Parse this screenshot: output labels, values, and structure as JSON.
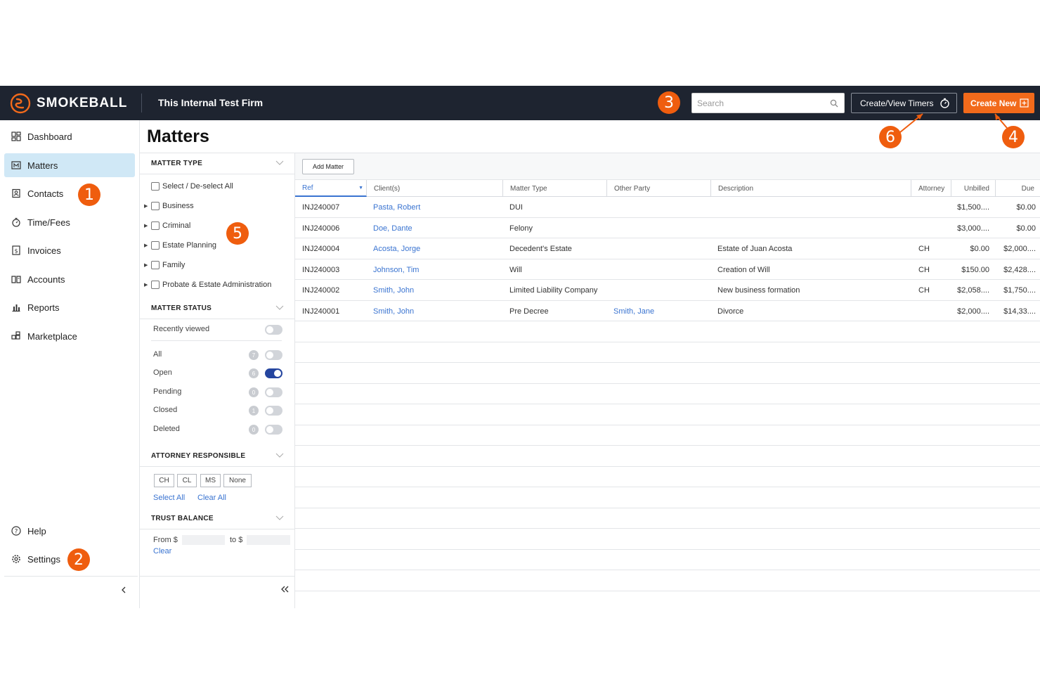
{
  "brand": {
    "logo_text": "SMOKEBALL",
    "firm_name": "This Internal Test Firm",
    "accent": "#f26a1b",
    "topbar_color": "#1e2430"
  },
  "header": {
    "search_placeholder": "Search",
    "timers_label": "Create/View Timers",
    "create_new_label": "Create New"
  },
  "callouts": [
    "1",
    "2",
    "3",
    "4",
    "5",
    "6"
  ],
  "sidebar": {
    "items": [
      {
        "label": "Dashboard",
        "icon": "dashboard-icon"
      },
      {
        "label": "Matters",
        "icon": "matters-icon",
        "active": true
      },
      {
        "label": "Contacts",
        "icon": "contacts-icon"
      },
      {
        "label": "Time/Fees",
        "icon": "stopwatch-icon"
      },
      {
        "label": "Invoices",
        "icon": "invoice-icon"
      },
      {
        "label": "Accounts",
        "icon": "accounts-icon"
      },
      {
        "label": "Reports",
        "icon": "reports-icon"
      },
      {
        "label": "Marketplace",
        "icon": "marketplace-icon"
      }
    ],
    "help_label": "Help",
    "settings_label": "Settings"
  },
  "page": {
    "title": "Matters",
    "add_matter_label": "Add Matter"
  },
  "filters": {
    "matter_type": {
      "title": "MATTER TYPE",
      "select_all": "Select / De-select All",
      "types": [
        "Business",
        "Criminal",
        "Estate Planning",
        "Family",
        "Probate & Estate Administration"
      ]
    },
    "matter_status": {
      "title": "MATTER STATUS",
      "recently_viewed": "Recently viewed",
      "statuses": [
        {
          "label": "All",
          "count": "7",
          "on": false
        },
        {
          "label": "Open",
          "count": "6",
          "on": true
        },
        {
          "label": "Pending",
          "count": "0",
          "on": false
        },
        {
          "label": "Closed",
          "count": "1",
          "on": false
        },
        {
          "label": "Deleted",
          "count": "0",
          "on": false
        }
      ]
    },
    "attorney": {
      "title": "ATTORNEY RESPONSIBLE",
      "options": [
        "CH",
        "CL",
        "MS",
        "None"
      ],
      "select_all": "Select All",
      "clear_all": "Clear All"
    },
    "trust": {
      "title": "TRUST BALANCE",
      "from_label": "From $",
      "to_label": "to $",
      "clear_label": "Clear"
    }
  },
  "table": {
    "columns": [
      "Ref",
      "Client(s)",
      "Matter Type",
      "Other Party",
      "Description",
      "Attorney",
      "Unbilled",
      "Due"
    ],
    "rows": [
      {
        "ref": "INJ240007",
        "client": "Pasta, Robert",
        "type": "DUI",
        "other": "",
        "desc": "",
        "attorney": "",
        "unbilled": "$1,500....",
        "due": "$0.00"
      },
      {
        "ref": "INJ240006",
        "client": "Doe, Dante",
        "type": "Felony",
        "other": "",
        "desc": "",
        "attorney": "",
        "unbilled": "$3,000....",
        "due": "$0.00"
      },
      {
        "ref": "INJ240004",
        "client": "Acosta, Jorge",
        "type": "Decedent's Estate",
        "other": "",
        "desc": "Estate of Juan Acosta",
        "attorney": "CH",
        "unbilled": "$0.00",
        "due": "$2,000...."
      },
      {
        "ref": "INJ240003",
        "client": "Johnson, Tim",
        "type": "Will",
        "other": "",
        "desc": "Creation of Will",
        "attorney": "CH",
        "unbilled": "$150.00",
        "due": "$2,428...."
      },
      {
        "ref": "INJ240002",
        "client": "Smith, John",
        "type": "Limited Liability Company",
        "other": "",
        "desc": "New business formation",
        "attorney": "CH",
        "unbilled": "$2,058....",
        "due": "$1,750...."
      },
      {
        "ref": "INJ240001",
        "client": "Smith, John",
        "type": "Pre Decree",
        "other": "Smith, Jane",
        "desc": "Divorce",
        "attorney": "",
        "unbilled": "$2,000....",
        "due": "$14,33...."
      }
    ]
  }
}
